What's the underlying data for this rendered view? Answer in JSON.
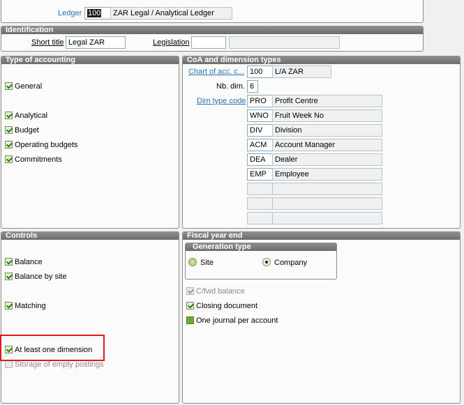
{
  "ledger": {
    "label": "Ledger",
    "code": "100",
    "description": "ZAR Legal / Analytical Ledger"
  },
  "identification": {
    "title": "Identification",
    "short_title_label": "Short title",
    "short_title_value": "Legal ZAR",
    "legislation_label": "Legislation",
    "legislation_value": "",
    "legislation_desc": ""
  },
  "type_of_accounting": {
    "title": "Type of accounting",
    "items": [
      {
        "label": "General",
        "checked": true
      },
      {
        "label": "Analytical",
        "checked": true
      },
      {
        "label": "Budget",
        "checked": true
      },
      {
        "label": "Operating budgets",
        "checked": true
      },
      {
        "label": "Commitments",
        "checked": true
      }
    ]
  },
  "coa": {
    "title": "CoA and dimension types",
    "chart_label": "Chart of acc. c...",
    "chart_code": "100",
    "chart_desc": "L/A ZAR",
    "nb_dim_label": "Nb. dim.",
    "nb_dim_value": "6",
    "dim_type_label": "Dim type code",
    "dims": [
      {
        "code": "PRO",
        "name": "Profit Centre"
      },
      {
        "code": "WNO",
        "name": "Fruit Week No"
      },
      {
        "code": "DIV",
        "name": "Division"
      },
      {
        "code": "ACM",
        "name": "Account Manager"
      },
      {
        "code": "DEA",
        "name": "Dealer"
      },
      {
        "code": "EMP",
        "name": "Employee"
      },
      {
        "code": "",
        "name": ""
      },
      {
        "code": "",
        "name": ""
      },
      {
        "code": "",
        "name": ""
      }
    ]
  },
  "controls": {
    "title": "Controls",
    "items": [
      {
        "label": "Balance",
        "checked": true
      },
      {
        "label": "Balance by site",
        "checked": true
      },
      {
        "label": "Matching",
        "checked": true
      },
      {
        "label": "At least one dimension",
        "checked": true
      },
      {
        "label": "Storage of empty postings",
        "checked": false,
        "disabled": true
      }
    ]
  },
  "fiscal": {
    "title": "Fiscal year end",
    "generation_type_title": "Generation type",
    "site_label": "Site",
    "company_label": "Company",
    "selected": "Company",
    "cfwd_label": "C/fwd balance",
    "closing_label": "Closing document",
    "one_journal_label": "One journal per account"
  },
  "colors": {
    "link": "#2a73b8",
    "header": "#7a7a7a",
    "highlight": "#e0181a",
    "check": "#2d7a10"
  }
}
